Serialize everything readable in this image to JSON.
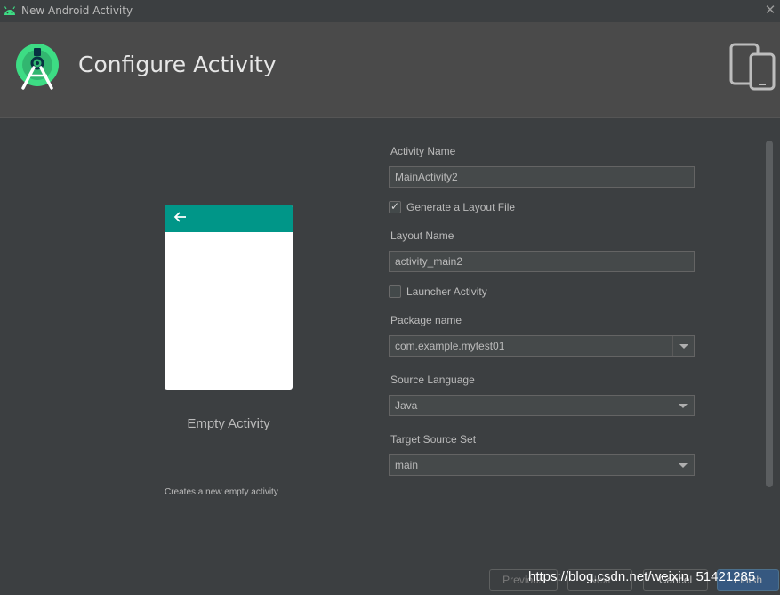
{
  "window": {
    "title": "New Android Activity",
    "close_glyph": "✕"
  },
  "header": {
    "heading": "Configure Activity"
  },
  "preview": {
    "template_name": "Empty Activity",
    "template_description": "Creates a new empty activity",
    "toolbar_color": "#009688"
  },
  "form": {
    "activity_name_label": "Activity Name",
    "activity_name_value": "MainActivity2",
    "generate_layout_label": "Generate a Layout File",
    "generate_layout_checked": true,
    "layout_name_label": "Layout Name",
    "layout_name_value": "activity_main2",
    "launcher_activity_label": "Launcher Activity",
    "launcher_activity_checked": false,
    "package_name_label": "Package name",
    "package_name_value": "com.example.mytest01",
    "source_language_label": "Source Language",
    "source_language_value": "Java",
    "target_source_set_label": "Target Source Set",
    "target_source_set_value": "main",
    "check_glyph": "✓"
  },
  "footer": {
    "previous_label": "Previous",
    "next_label": "Next",
    "cancel_label": "Cancel",
    "finish_label": "Finish",
    "watermark": "https://blog.csdn.net/weixin_51421285"
  },
  "colors": {
    "background": "#3c3f41",
    "header_background": "#4a4a4a",
    "android_green": "#3ddc84",
    "primary_button": "#365880"
  },
  "icons": {
    "window_icon": "android-icon",
    "logo": "android-studio-logo",
    "devices": "phone-tablet-icon",
    "back": "arrow-left-icon"
  }
}
